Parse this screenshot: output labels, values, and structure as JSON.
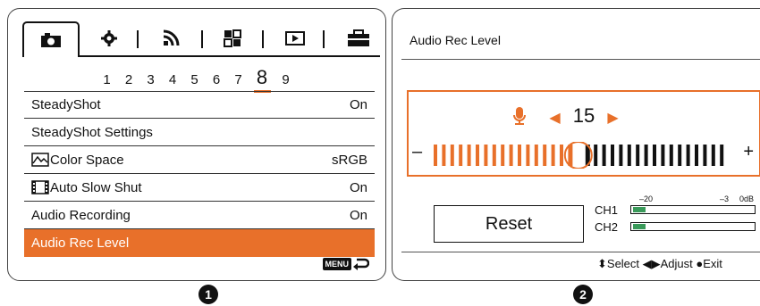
{
  "panel1": {
    "tabs": [
      {
        "icon": "camera-icon"
      },
      {
        "icon": "gear-icon"
      },
      {
        "icon": "network-icon"
      },
      {
        "icon": "grid-icon"
      },
      {
        "icon": "playback-icon"
      },
      {
        "icon": "toolbox-icon"
      }
    ],
    "pages": [
      "1",
      "2",
      "3",
      "4",
      "5",
      "6",
      "7",
      "8",
      "9"
    ],
    "current_page": "8",
    "items": [
      {
        "label": "SteadyShot",
        "value": "On"
      },
      {
        "label": "SteadyShot Settings",
        "value": ""
      },
      {
        "label": "Color Space",
        "value": "sRGB",
        "icon": "color-space-icon"
      },
      {
        "label": "Auto Slow Shut",
        "value": "On",
        "icon": "film-icon"
      },
      {
        "label": "Audio Recording",
        "value": "On"
      },
      {
        "label": "Audio Rec Level",
        "value": "",
        "selected": true
      }
    ],
    "menu_badge": "MENU",
    "number": "1"
  },
  "panel2": {
    "title": "Audio Rec Level",
    "level": "15",
    "minus": "–",
    "plus": "+",
    "level_fraction": 0.5,
    "reset": "Reset",
    "ch1": "CH1",
    "ch2": "CH2",
    "scale_labels": [
      "–20",
      "–3",
      "0dB"
    ],
    "help": "⬍Select ◀▶Adjust ●Exit",
    "number": "2",
    "accent": "#e8702a"
  }
}
